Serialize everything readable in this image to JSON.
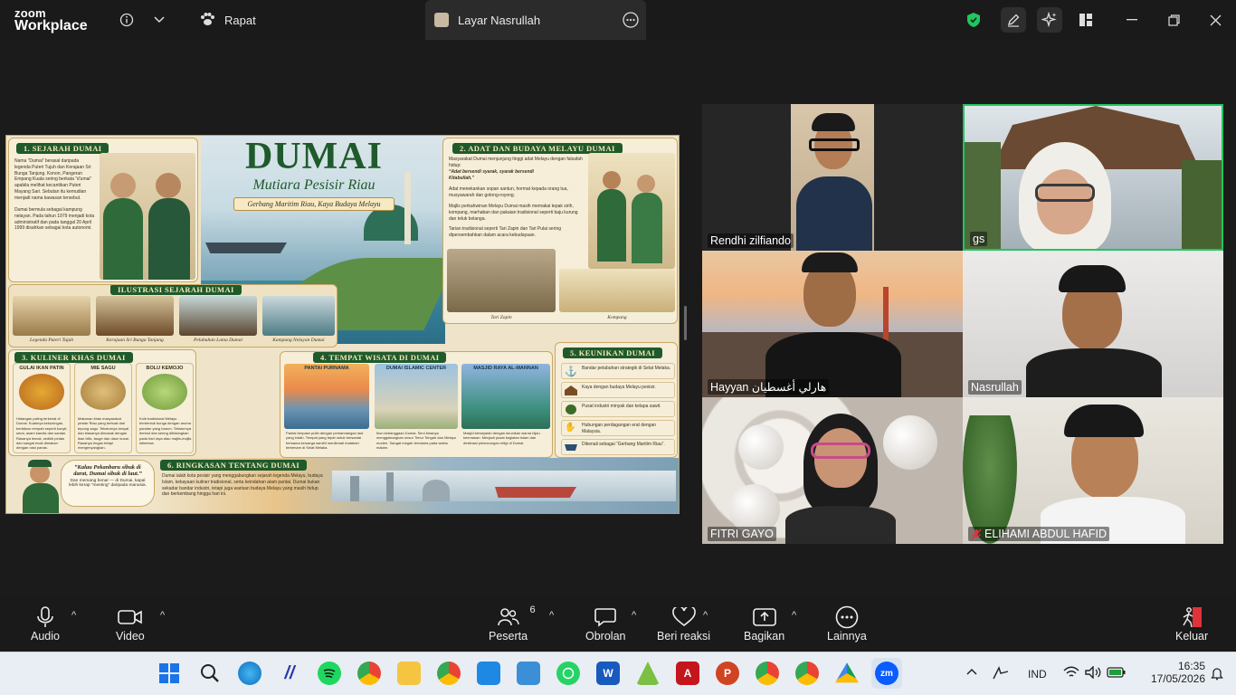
{
  "app": {
    "brand_line1": "zoom",
    "brand_line2": "Workplace"
  },
  "tabs": [
    {
      "label": "Rapat"
    },
    {
      "label": "Layar Nasrullah"
    }
  ],
  "poster": {
    "title": "DUMAI",
    "subtitle": "Mutiara Pesisir Riau",
    "tagline": "Gerbang Maritim Riau, Kaya Budaya Melayu",
    "s1_title": "1. SEJARAH DUMAI",
    "s1_text": "Nama “Dumai” berasal daripada legenda Puteri Tujuh dan Kerajaan Sri Bunga Tanjung. Konon, Pangeran Empang Kuala sering berkata “d'umai” apabila melihat kecantikan Puteri Mayang Sari. Sebutan itu kemudian menjadi nama kawasan tersebut.",
    "s1_text2": "Dumai bermula sebagai kampung nelayan. Pada tahun 1979 menjadi kota administratif dan pada tanggal 20 April 1999 disahkan sebagai kota autonomi.",
    "s2_title": "2. ADAT DAN BUDAYA MELAYU DUMAI",
    "s2_text": "Masyarakat Dumai menjunjung tinggi adat Melayu dengan falsafah hidup:",
    "s2_quote": "“Adat bersendi syarak, syarak bersendi Kitabullah.”",
    "s2_text2": "Adat menekankan sopan santun, hormat kepada orang tua, musyawarah dan gotong-royong.",
    "s2_text3": "Majlis perkahwinan Melayu Dumai masih memakai tepak sirih, kompang, marhaban dan pakaian tradisional seperti baju kurung dan teluk belanga.",
    "s2_text4": "Tarian tradisional seperti Tari Zapin dan Tari Pulai sering dipersembahkan dalam acara kebudayaan.",
    "s2_cap1": "Tari Zapin",
    "s2_cap2": "Kompang",
    "ilus_title": "ILUSTRASI SEJARAH DUMAI",
    "ilus_caps": [
      "Legenda Puteri Tujuh",
      "Kerajaan Sri Bunga Tanjung",
      "Pelabuhan Lama Dumai",
      "Kampung Nelayan Dumai"
    ],
    "s3_title": "3. KULINER KHAS DUMAI",
    "s3_items": [
      {
        "name": "GULAI IKAN PATIN",
        "text": "Hidangan paling terkenal di Dumai. Kuahnya kekuningan, berisikan rempah seperti kunyit, serai, asam kandis dan santan. Rasanya lemak, sedikit pedas dan sangat enak dimakan dengan nasi panas."
      },
      {
        "name": "MIE SAGU",
        "text": "Makanan khas masyarakat pesisir Riau yang terbuat dari tepung sagu. Teksturnya kenyal dan biasanya dimasak dengan ikan bilis, tauge dan daun kucai. Rasanya ringan tetapi mengenyangkan."
      },
      {
        "name": "BOLU KEMOJO",
        "text": "Kuih tradisional Melayu berbentuk bunga dengan aroma pandan yang harum. Teksturnya lembut dan sering dihidangkan pada hari raya atau majlis-majlis istimewa."
      }
    ],
    "s4_title": "4. TEMPAT WISATA DI DUMAI",
    "s4_items": [
      {
        "name": "PANTAI PURNAMA",
        "text": "Pantai berpasir putih dengan pemandangan laut yang indah. Tempat yang tepat untuk bersantai bersama keluarga sambil menikmati matahari terbenam di Selat Melaka."
      },
      {
        "name": "DUMAI ISLAMIC CENTER",
        "text": "Ikon kebanggaan Dumai. Seni binanya menggabungkan unsur Timur Tengah dan Melayu moden. Sangat megah terutama pada waktu malam."
      },
      {
        "name": "MASJID RAYA AL-MANNAN",
        "text": "Masjid bersejarah dengan keunikan warna hijau keemasan. Menjadi pusat kegiatan Islam dan destinasi pelancongan religi di Dumai."
      }
    ],
    "s5_title": "5. KEUNIKAN DUMAI",
    "s5_items": [
      "Bandar pelabuhan strategik di Selat Melaka.",
      "Kaya dengan budaya Melayu pesisir.",
      "Pusat industri minyak dan kelapa sawit.",
      "Hubungan perdagangan erat dengan Malaysia.",
      "Dikenali sebagai “Gerbang Maritim Riau”."
    ],
    "quote": "“Kalau Pekanbaru sibuk di darat, Dumai sibuk di laut.”",
    "quote_sub": "Dan memang benar — di Dumai, kapal lebih kerap “meeting” daripada manusia.",
    "s6_title": "6. RINGKASAN TENTANG DUMAI",
    "s6_text": "Dumai ialah kota pesisir yang menggabungkan sejarah legenda Melayu, budaya Islam, kekayaan kuliner tradisional, serta keindahan alam pantai. Dumai bukan sekadar bandar industri, tetapi juga warisan budaya Melayu yang masih hidup dan berkembang hingga hari ini."
  },
  "participants": [
    {
      "name": "Rendhi zilfiando"
    },
    {
      "name": "gs"
    },
    {
      "name": "Hayyan هارلي أغسطيان"
    },
    {
      "name": "Nasrullah"
    },
    {
      "name": "FITRI GAYO"
    },
    {
      "name": "ELIHAMI ABDUL HAFID"
    }
  ],
  "toolbar": {
    "audio": "Audio",
    "video": "Video",
    "participants": "Peserta",
    "participants_count": "6",
    "chat": "Obrolan",
    "react": "Beri reaksi",
    "share": "Bagikan",
    "more": "Lainnya",
    "leave": "Keluar"
  },
  "taskbar": {
    "lang": "IND",
    "time": "16:35",
    "date": "17/05/2026",
    "zoom_label": "zm"
  },
  "colors": {
    "accent_green": "#22c55e",
    "leave_red": "#e0323b",
    "poster_green": "#1f5a2c"
  }
}
